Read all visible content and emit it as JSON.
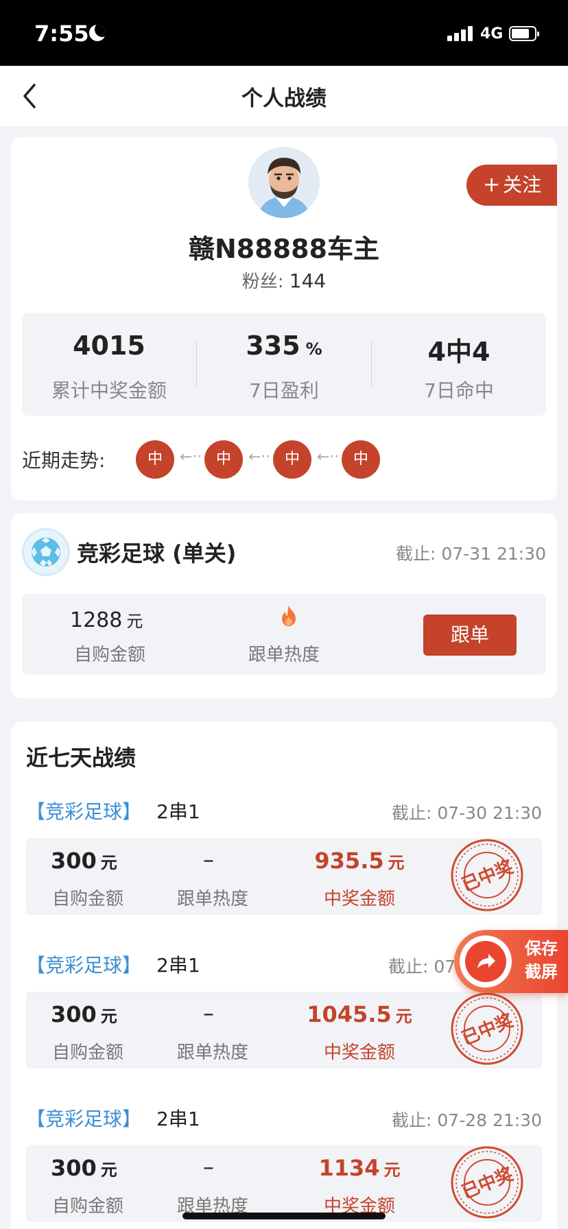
{
  "status_bar": {
    "time": "7:55",
    "network": "4G"
  },
  "nav": {
    "title": "个人战绩"
  },
  "profile": {
    "name": "赣N88888车主",
    "fans_label": "粉丝:",
    "fans_count": "144",
    "follow_label": "关注",
    "stats": [
      {
        "value": "4015",
        "unit": "",
        "label": "累计中奖金额"
      },
      {
        "value": "335",
        "unit": "%",
        "label": "7日盈利"
      },
      {
        "value": "4中4",
        "unit": "",
        "label": "7日命中"
      }
    ],
    "trend_label": "近期走势:",
    "trend": [
      "中",
      "中",
      "中",
      "中"
    ],
    "trend_arrow": "←··"
  },
  "pick": {
    "title": "竞彩足球 (单关)",
    "deadline": "截止: 07-31 21:30",
    "amount": "1288",
    "unit": "元",
    "amount_label": "自购金额",
    "heat_label": "跟单热度",
    "button": "跟单"
  },
  "history": {
    "title": "近七天战绩",
    "records": [
      {
        "tag": "【竞彩足球】",
        "type": "2串1",
        "deadline": "截止: 07-30 21:30",
        "amount": "300",
        "unit": "元",
        "amount_label": "自购金额",
        "heat": "–",
        "heat_label": "跟单热度",
        "prize": "935.5",
        "prize_unit": "元",
        "prize_label": "中奖金额",
        "stamp": "已中奖"
      },
      {
        "tag": "【竞彩足球】",
        "type": "2串1",
        "deadline": "截止: 07",
        "amount": "300",
        "unit": "元",
        "amount_label": "自购金额",
        "heat": "–",
        "heat_label": "跟单热度",
        "prize": "1045.5",
        "prize_unit": "元",
        "prize_label": "中奖金额",
        "stamp": "已中奖"
      },
      {
        "tag": "【竞彩足球】",
        "type": "2串1",
        "deadline": "截止: 07-28 21:30",
        "amount": "300",
        "unit": "元",
        "amount_label": "自购金额",
        "heat": "–",
        "heat_label": "跟单热度",
        "prize": "1134",
        "prize_unit": "元",
        "prize_label": "中奖金额",
        "stamp": "已中奖"
      }
    ]
  },
  "save_screenshot": {
    "line1": "保存",
    "line2": "截屏"
  },
  "colors": {
    "accent": "#c4432a",
    "tag_blue": "#3a8ed6",
    "background": "#f2f3f7"
  },
  "icons": [
    "moon-icon",
    "signal-icon",
    "battery-icon",
    "back-icon",
    "plus-icon",
    "football-icon",
    "fire-icon",
    "winning-stamp-icon",
    "share-icon"
  ]
}
